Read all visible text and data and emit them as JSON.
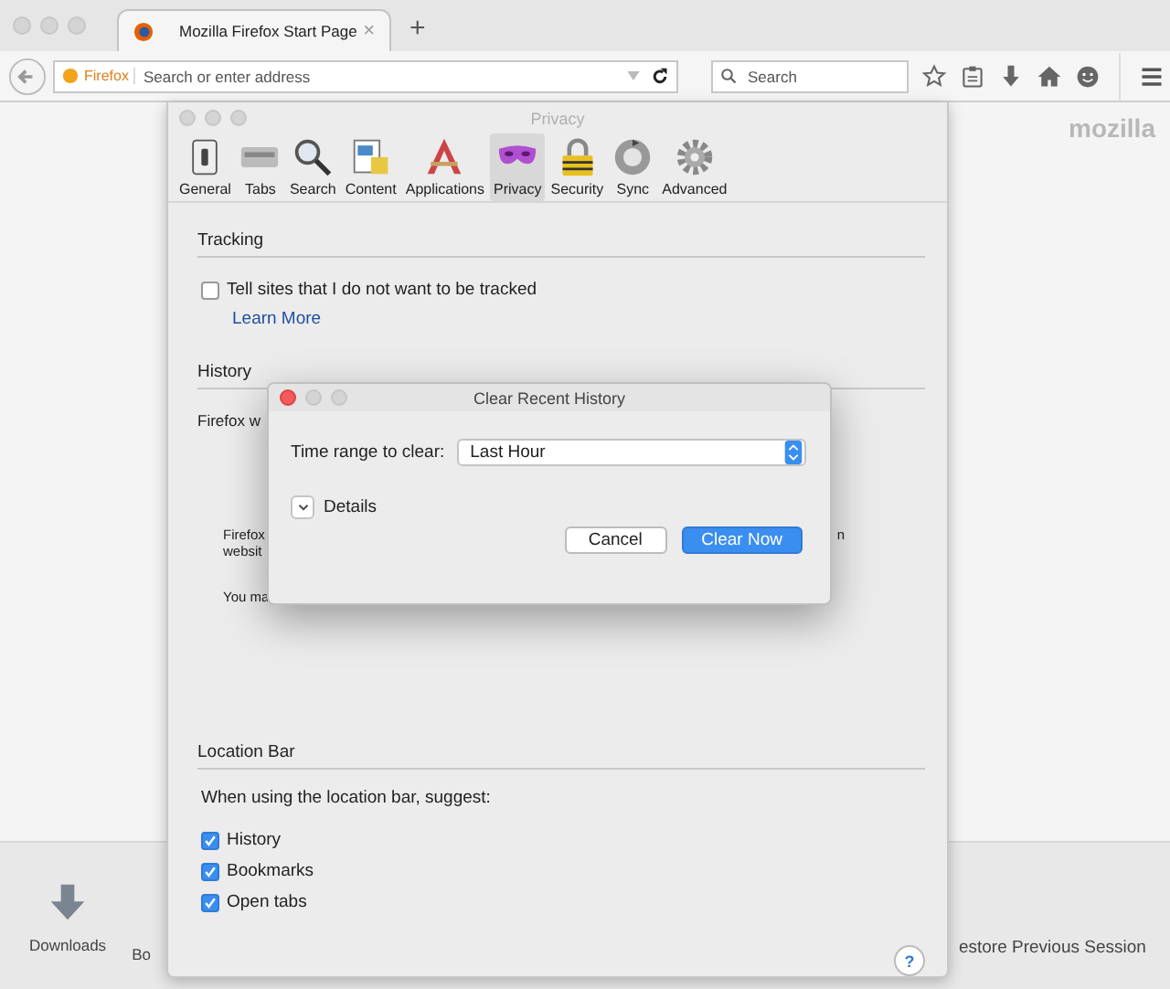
{
  "browser": {
    "tab": {
      "title": "Mozilla Firefox Start Page",
      "close": "×"
    },
    "new_tab": "+",
    "url_field": {
      "identity": "Firefox",
      "placeholder": "Search or enter address"
    },
    "search_field": {
      "placeholder": "Search"
    }
  },
  "page": {
    "logo": "mozilla",
    "downloads": "Downloads",
    "bookmarks_partial": "Bo",
    "restore_partial": "estore Previous Session"
  },
  "preferences": {
    "title": "Privacy",
    "tabs": [
      {
        "label": "General",
        "kind": "general",
        "selected": false
      },
      {
        "label": "Tabs",
        "kind": "tabs",
        "selected": false
      },
      {
        "label": "Search",
        "kind": "search",
        "selected": false
      },
      {
        "label": "Content",
        "kind": "content",
        "selected": false
      },
      {
        "label": "Applications",
        "kind": "applications",
        "selected": false
      },
      {
        "label": "Privacy",
        "kind": "privacy",
        "selected": true
      },
      {
        "label": "Security",
        "kind": "security",
        "selected": false
      },
      {
        "label": "Sync",
        "kind": "sync",
        "selected": false
      },
      {
        "label": "Advanced",
        "kind": "advanced",
        "selected": false
      }
    ],
    "tracking": {
      "heading": "Tracking",
      "checkbox": {
        "label": "Tell sites that I do not want to be tracked",
        "checked": false
      },
      "link": "Learn More"
    },
    "history": {
      "heading": "History",
      "intro_partial": "Firefox w",
      "line_1_partial": "Firefox",
      "line_1_tail": "n",
      "line_2_partial": "websit",
      "line_3_partial": "You ma"
    },
    "location_bar": {
      "heading": "Location Bar",
      "prompt": "When using the location bar, suggest:",
      "options": [
        {
          "label": "History",
          "checked": true
        },
        {
          "label": "Bookmarks",
          "checked": true
        },
        {
          "label": "Open tabs",
          "checked": true
        }
      ]
    },
    "help": "?"
  },
  "dialog": {
    "title": "Clear Recent History",
    "range_label": "Time range to clear:",
    "range_value": "Last Hour",
    "details": {
      "label": "Details",
      "expanded": false
    },
    "buttons": [
      {
        "label": "Cancel",
        "default": false
      },
      {
        "label": "Clear Now",
        "default": true
      }
    ]
  }
}
